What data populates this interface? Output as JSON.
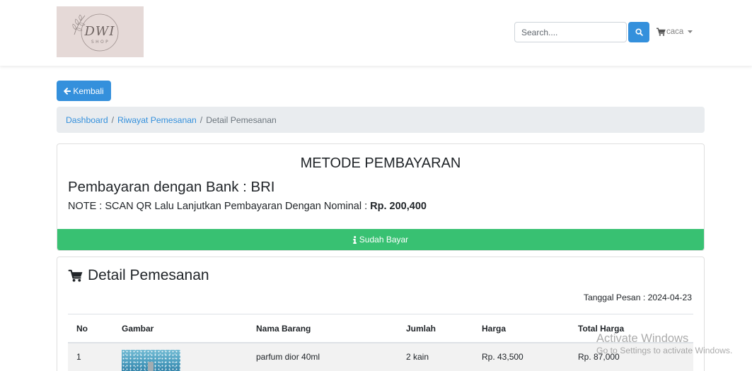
{
  "navbar": {
    "logo": {
      "text": "DWI",
      "subtext": "SHOP"
    },
    "search": {
      "placeholder": "Search...."
    },
    "user": {
      "name": "caca"
    }
  },
  "back_button": {
    "label": "Kembali"
  },
  "breadcrumb": {
    "separator": "/",
    "items": [
      "Dashboard",
      "Riwayat Pemesanan",
      "Detail Pemesanan"
    ]
  },
  "payment": {
    "heading": "METODE PEMBAYARAN",
    "bank_label": "Pembayaran dengan Bank :",
    "bank_name": "BRI",
    "note_label": "NOTE : SCAN QR Lalu Lanjutkan Pembayaran Dengan Nominal :",
    "note_amount": "Rp. 200,400",
    "paid_button_label": "Sudah Bayar"
  },
  "order": {
    "title": "Detail Pemesanan",
    "date_label": "Tanggal Pesan :",
    "date_value": "2024-04-23",
    "columns": [
      "No",
      "Gambar",
      "Nama Barang",
      "Jumlah",
      "Harga",
      "Total Harga"
    ],
    "rows": [
      {
        "no": "1",
        "name": "parfum dior 40ml",
        "qty": "2 kain",
        "price": "Rp. 43,500",
        "total": "Rp. 87,000"
      }
    ]
  },
  "os_watermark": {
    "title": "Activate Windows",
    "subtitle": "Go to Settings to activate Windows."
  },
  "colors": {
    "primary": "#3490dc",
    "success": "#38c172",
    "breadcrumb_bg": "#e9ecef",
    "logo_bg": "#e5d9d7"
  },
  "icons": {
    "search": "search-icon",
    "nav_cart": "cart-icon",
    "user_menu": "caret-down-icon",
    "back": "arrow-left-icon",
    "paid": "info-icon",
    "order_title": "cart-icon"
  }
}
